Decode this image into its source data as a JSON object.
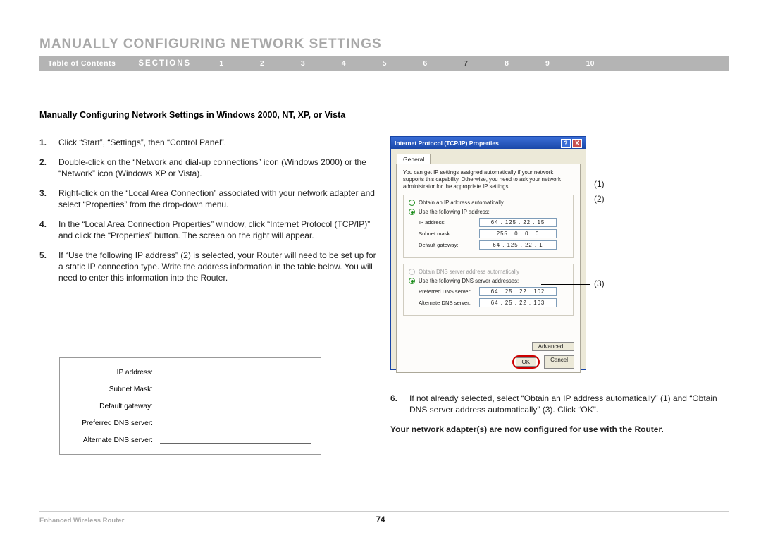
{
  "page_title": "MANUALLY CONFIGURING NETWORK SETTINGS",
  "nav": {
    "toc": "Table of Contents",
    "sections_label": "SECTIONS",
    "numbers": [
      "1",
      "2",
      "3",
      "4",
      "5",
      "6",
      "7",
      "8",
      "9",
      "10"
    ],
    "active": "7"
  },
  "heading": "Manually Configuring Network Settings in Windows 2000, NT, XP, or Vista",
  "steps_left": [
    {
      "n": "1.",
      "text": "Click “Start”, “Settings”, then “Control Panel”."
    },
    {
      "n": "2.",
      "text": "Double-click on the “Network and dial-up connections” icon (Windows 2000) or the “Network” icon (Windows XP or Vista)."
    },
    {
      "n": "3.",
      "text": "Right-click on the “Local Area Connection” associated with your network adapter and select “Properties” from the drop-down menu."
    },
    {
      "n": "4.",
      "text": "In the “Local Area Connection Properties” window, click “Internet Protocol (TCP/IP)” and click the “Properties” button. The screen on the right will appear."
    },
    {
      "n": "5.",
      "text": "If “Use the following IP address” (2) is selected, your Router will need to be set up for a static IP connection type. Write the address information in the table below. You will need to enter this information into the Router."
    }
  ],
  "blank_table_labels": [
    "IP address:",
    "Subnet Mask:",
    "Default gateway:",
    "Preferred DNS server:",
    "Alternate DNS server:"
  ],
  "dialog": {
    "title": "Internet Protocol (TCP/IP) Properties",
    "tab": "General",
    "intro": "You can get IP settings assigned automatically if your network supports this capability. Otherwise, you need to ask your network administrator for the appropriate IP settings.",
    "r1": "Obtain an IP address automatically",
    "r2": "Use the following IP address:",
    "f_ip_l": "IP address:",
    "f_ip_v": "64 . 125 . 22 . 15",
    "f_sm_l": "Subnet mask:",
    "f_sm_v": "255 .  0  .  0  .  0",
    "f_gw_l": "Default gateway:",
    "f_gw_v": "64 . 125 . 22 .  1",
    "r3": "Obtain DNS server address automatically",
    "r4": "Use the following DNS server addresses:",
    "f_pd_l": "Preferred DNS server:",
    "f_pd_v": "64 . 25 . 22 . 102",
    "f_ad_l": "Alternate DNS server:",
    "f_ad_v": "64 . 25 . 22 . 103",
    "adv": "Advanced...",
    "ok": "OK",
    "cancel": "Cancel"
  },
  "callouts": {
    "c1": "(1)",
    "c2": "(2)",
    "c3": "(3)"
  },
  "step6": {
    "n": "6.",
    "text": "If not already selected, select “Obtain an IP address automatically” (1) and “Obtain DNS server address automatically” (3). Click “OK”."
  },
  "final_note": "Your network adapter(s) are now configured for use with the Router.",
  "footer_left": "Enhanced Wireless Router",
  "page_num": "74"
}
